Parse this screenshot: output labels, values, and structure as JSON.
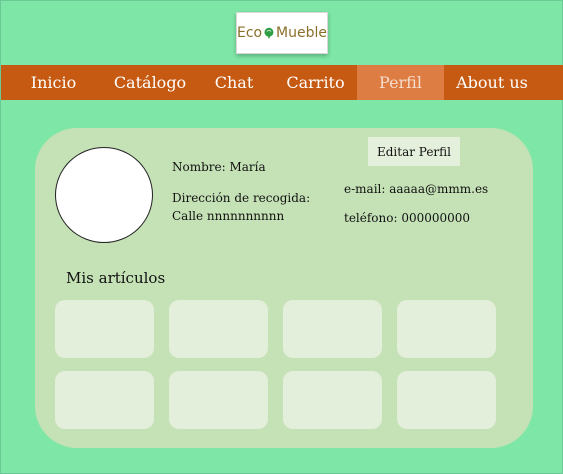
{
  "logo": {
    "text_left": "Eco",
    "text_right": "Mueble"
  },
  "nav": {
    "items": [
      {
        "label": "Inicio",
        "active": false
      },
      {
        "label": "Catálogo",
        "active": false
      },
      {
        "label": "Chat",
        "active": false
      },
      {
        "label": "Carrito",
        "active": false
      },
      {
        "label": "Perfil",
        "active": true
      },
      {
        "label": "About us",
        "active": false
      }
    ]
  },
  "profile": {
    "name": "Nombre: María",
    "address": "Dirección de recogida: Calle nnnnnnnnnn",
    "email": "e-mail: aaaaa@mmm.es",
    "phone": "teléfono: 000000000",
    "edit_label": "Editar Perfil"
  },
  "articles": {
    "title": "Mis artículos",
    "count": 8
  },
  "colors": {
    "background": "#7ee6a6",
    "navbar": "#c65a12",
    "nav_active": "#de7d43",
    "card": "#c5e2b6",
    "tile": "#e3eedb",
    "logo_leaf": "#2f9e44"
  }
}
